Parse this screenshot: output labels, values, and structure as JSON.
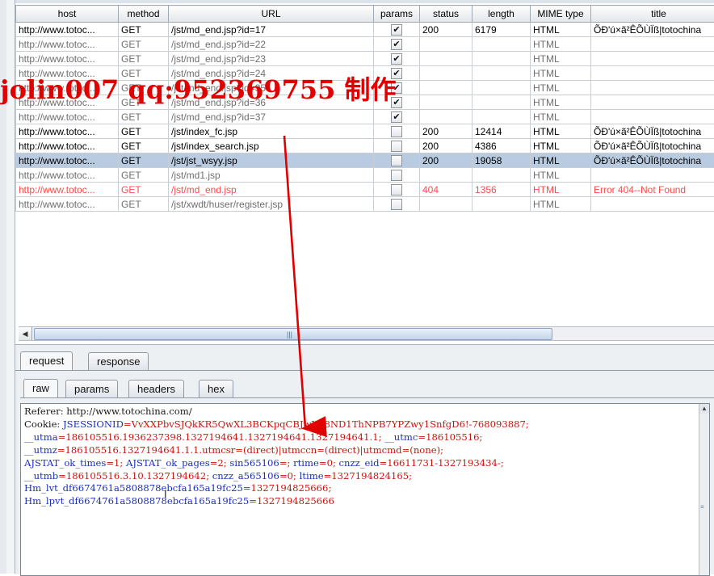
{
  "table": {
    "columns": [
      "host",
      "method",
      "URL",
      "params",
      "status",
      "length",
      "MIME type",
      "title"
    ],
    "rows": [
      {
        "host": "http://www.totoc...",
        "method": "GET",
        "url": "/jst/md_end.jsp?id=17",
        "params": true,
        "status": "200",
        "length": "6179",
        "mime": "HTML",
        "title": "ÕÐ'ú×ã²ÊÕÙÏß|totochina",
        "style": "dark"
      },
      {
        "host": "http://www.totoc...",
        "method": "GET",
        "url": "/jst/md_end.jsp?id=22",
        "params": true,
        "status": "",
        "length": "",
        "mime": "HTML",
        "title": "",
        "style": "gray"
      },
      {
        "host": "http://www.totoc...",
        "method": "GET",
        "url": "/jst/md_end.jsp?id=23",
        "params": true,
        "status": "",
        "length": "",
        "mime": "HTML",
        "title": "",
        "style": "gray"
      },
      {
        "host": "http://www.totoc...",
        "method": "GET",
        "url": "/jst/md_end.jsp?id=24",
        "params": true,
        "status": "",
        "length": "",
        "mime": "HTML",
        "title": "",
        "style": "gray"
      },
      {
        "host": "http://www.totoc...",
        "method": "GET",
        "url": "/jst/md_end.jsp?id=35",
        "params": true,
        "status": "",
        "length": "",
        "mime": "HTML",
        "title": "",
        "style": "gray"
      },
      {
        "host": "http://www.totoc...",
        "method": "GET",
        "url": "/jst/md_end.jsp?id=36",
        "params": true,
        "status": "",
        "length": "",
        "mime": "HTML",
        "title": "",
        "style": "gray"
      },
      {
        "host": "http://www.totoc...",
        "method": "GET",
        "url": "/jst/md_end.jsp?id=37",
        "params": true,
        "status": "",
        "length": "",
        "mime": "HTML",
        "title": "",
        "style": "gray"
      },
      {
        "host": "http://www.totoc...",
        "method": "GET",
        "url": "/jst/index_fc.jsp",
        "params": false,
        "status": "200",
        "length": "12414",
        "mime": "HTML",
        "title": "ÕÐ'ú×ã²ÊÕÙÏß|totochina",
        "style": "dark"
      },
      {
        "host": "http://www.totoc...",
        "method": "GET",
        "url": "/jst/index_search.jsp",
        "params": false,
        "status": "200",
        "length": "4386",
        "mime": "HTML",
        "title": "ÕÐ'ú×ã²ÊÕÙÏß|totochina",
        "style": "dark"
      },
      {
        "host": "http://www.totoc...",
        "method": "GET",
        "url": "/jst/jst_wsyy.jsp",
        "params": false,
        "status": "200",
        "length": "19058",
        "mime": "HTML",
        "title": "ÕÐ'ú×ã²ÊÕÙÏß|totochina",
        "style": "selected"
      },
      {
        "host": "http://www.totoc...",
        "method": "GET",
        "url": "/jst/md1.jsp",
        "params": false,
        "status": "",
        "length": "",
        "mime": "HTML",
        "title": "",
        "style": "gray"
      },
      {
        "host": "http://www.totoc...",
        "method": "GET",
        "url": "/jst/md_end.jsp",
        "params": false,
        "status": "404",
        "length": "1356",
        "mime": "HTML",
        "title": "Error 404--Not Found",
        "style": "red"
      },
      {
        "host": "http://www.totoc...",
        "method": "GET",
        "url": "/jst/xwdt/huser/register.jsp",
        "params": false,
        "status": "",
        "length": "",
        "mime": "HTML",
        "title": "",
        "style": "gray"
      }
    ]
  },
  "tabs_top": [
    "request",
    "response"
  ],
  "tabs_sub": [
    "raw",
    "params",
    "headers",
    "hex"
  ],
  "raw": {
    "referer_label": "Referer: http://www.totochina.com/",
    "cookie_label": "Cookie: ",
    "cookie_jsession_key": "JSESSIONID",
    "cookie_jsession_val": "=VvXXPbvSJQkKR5QwXL3BCKpqCBJwXT8ND1ThNPB7YPZwy1SnfgD6!-768093887;",
    "utma_key": "__utma",
    "utma_val": "=186105516.1936237398.1327194641.1327194641.1327194641.1;",
    "utmc_key": " __utmc",
    "utmc_val": "=186105516;",
    "utmz_key": "__utmz",
    "utmz_val": "=186105516.1327194641.1.1.utmcsr=(direct)|utmccn=(direct)|utmcmd=(none);",
    "ajstat_times_key": "AJSTAT_ok_times",
    "ajstat_times_val": "=1;",
    "ajstat_pages_key": " AJSTAT_ok_pages",
    "ajstat_pages_val": "=2;",
    "sin_key": " sin565106",
    "sin_val": "=;",
    "rtime_key": " rtime",
    "rtime_val": "=0;",
    "cnzz_eid_key": " cnzz_eid",
    "cnzz_eid_val": "=16611731-1327193434-;",
    "utmb_key": "__utmb",
    "utmb_val": "=186105516.3.10.1327194642;",
    "cnzz_a_key": " cnzz_a565106",
    "cnzz_a_val": "=0;",
    "ltime_key": " ltime",
    "ltime_val": "=1327194824165;",
    "hm_lvt_key": "Hm_lvt_df6674761a5808878ebcfa165a19fc25",
    "hm_lvt_val": "=1327194825666;",
    "hm_lpvt_key": "Hm_lpvt_df6674761a5808878ebcfa165a19fc25",
    "hm_lpvt_val": "=1327194825666"
  },
  "watermark": "jolin007 qq:952369755 制作",
  "colors": {
    "selected_row": "#b9cbe0",
    "error_row": "#ff4a4a",
    "cookie_key": "#1b2fb5",
    "cookie_value": "#c8140e",
    "watermark": "#e00000"
  }
}
